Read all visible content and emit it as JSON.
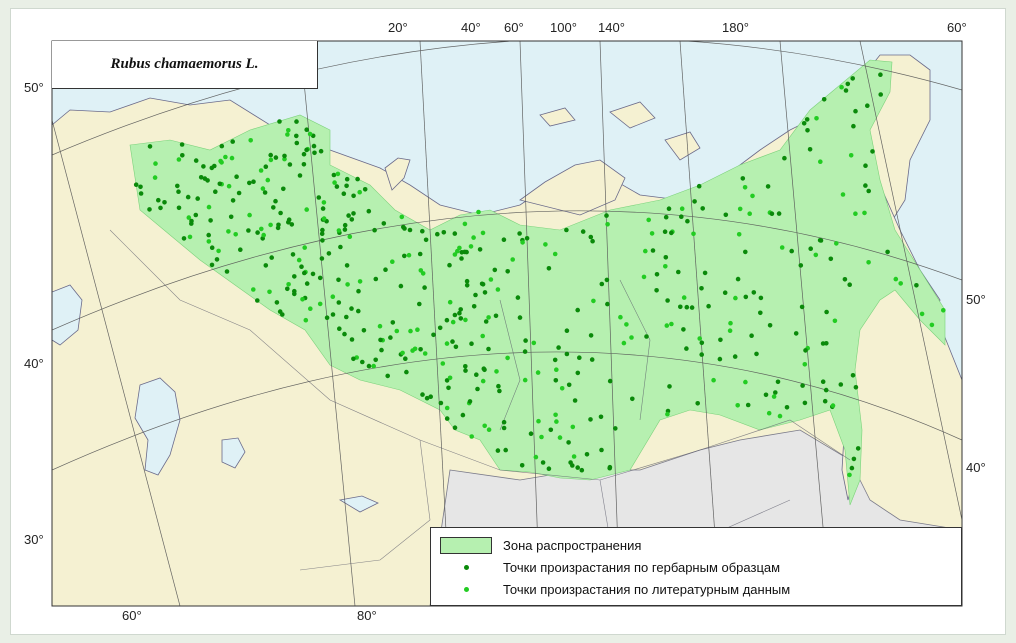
{
  "map": {
    "title": "Rubus chamaemorus L.",
    "colors": {
      "background": "#e9efe6",
      "sea": "#dff1f6",
      "land_outside": "#f5f1d2",
      "land_other": "#e6e6e6",
      "range_zone": "#b6f0b0",
      "herbarium_points": "#0a8a0a",
      "literature_points": "#22cc22",
      "graticule": "#555555",
      "borders": "#555577"
    },
    "graticule_labels": {
      "top": [
        "20°",
        "40°",
        "60°",
        "100°",
        "140°",
        "180°",
        "60°"
      ],
      "left": [
        "50°",
        "40°",
        "30°"
      ],
      "bottom": [
        "60°",
        "80°"
      ],
      "right": [
        "50°",
        "40°"
      ]
    },
    "legend": {
      "zone_label": "Зона распространения",
      "herbarium_label": "Точки произрастания по гербарным образцам",
      "literature_label": "Точки произрастания по литературным данным"
    }
  }
}
